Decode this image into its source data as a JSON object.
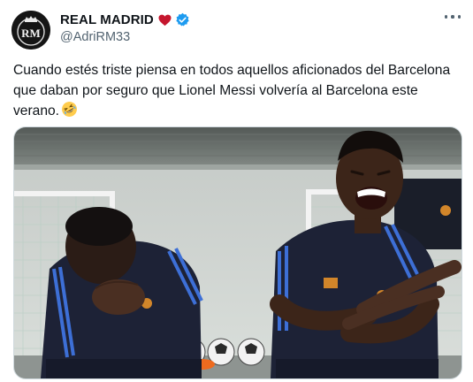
{
  "author": {
    "display_name": "REAL MADRID",
    "handle": "@AdriRM33",
    "avatar_logo_text": "RM",
    "heart_icon": "red-heart-emoji",
    "verified_icon": "verified-badge-icon",
    "verified_color": "#1d9bf0",
    "heart_color": "#c5162e"
  },
  "menu": {
    "icon": "more-options-icon"
  },
  "tweet": {
    "lines": [
      "Cuando estés triste piensa en todos aquellos aficionados del Barcelona",
      "que daban por seguro que Lionel Messi volvería al Barcelona este",
      "verano."
    ],
    "emoji": "rolling-on-floor-laughing-emoji"
  },
  "media": {
    "type": "photo",
    "description_icon": "two-football-players-laughing-photo"
  }
}
